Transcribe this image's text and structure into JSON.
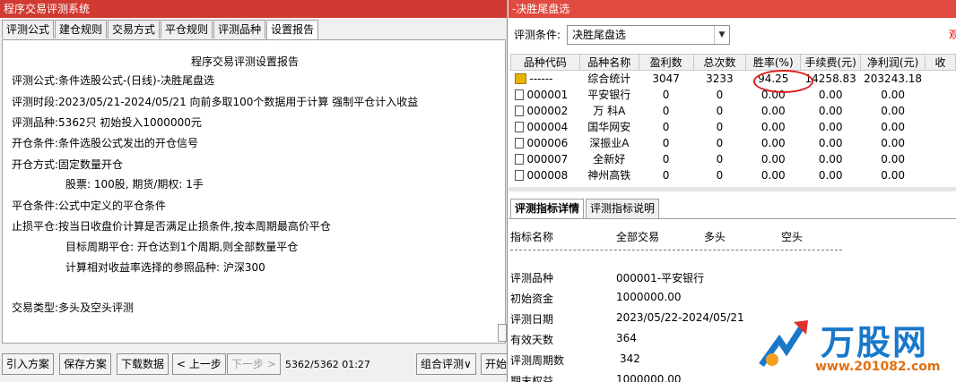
{
  "left": {
    "title": "程序交易评测系统",
    "tabs": [
      "评测公式",
      "建仓规则",
      "交易方式",
      "平仓规则",
      "评测品种",
      "设置报告"
    ],
    "active_tab": 5,
    "report": {
      "title": "程序交易评测设置报告",
      "lines": [
        {
          "k": "评测公式:",
          "v": "条件选股公式-(日线)-决胜尾盘选"
        },
        {
          "k": "评测时段:",
          "v": "2023/05/21-2024/05/21 向前多取100个数据用于计算 强制平仓计入收益"
        },
        {
          "k": "评测品种:",
          "v": "5362只 初始投入1000000元"
        },
        {
          "k": "开仓条件:",
          "v": "条件选股公式发出的开仓信号"
        },
        {
          "k": "开仓方式:",
          "v": "固定数量开仓"
        },
        {
          "k": "",
          "v": "股票: 100股, 期货/期权: 1手"
        },
        {
          "k": "平仓条件:",
          "v": "公式中定义的平仓条件"
        },
        {
          "k": "止损平仓:",
          "v": "按当日收盘价计算是否满足止损条件,按本周期最高价平仓"
        },
        {
          "k": "",
          "v": "目标周期平仓: 开仓达到1个周期,则全部数量平仓"
        },
        {
          "k": "",
          "v": "计算相对收益率选择的参照品种: 沪深300"
        },
        {
          "k": "交易类型:",
          "v": "多头及空头评测"
        }
      ]
    },
    "buttons": {
      "import": "引入方案",
      "save": "保存方案",
      "download": "下载数据",
      "prev": "< 上一步",
      "next": "下一步 >",
      "combo_eval": "组合评测∨",
      "start_clip": "开始"
    },
    "status": "5362/5362  01:27"
  },
  "right": {
    "title": "-决胜尾盘选",
    "condition_label": "评测条件:",
    "condition_value": "决胜尾盘选",
    "red_clip": "观",
    "table": {
      "headers": [
        "品种代码",
        "品种名称",
        "盈利数",
        "总次数",
        "胜率(%)",
        "手续费(元)",
        "净利润(元)",
        "收"
      ],
      "rows": [
        [
          "------",
          "综合统计",
          "3047",
          "3233",
          "94.25",
          "14258.83",
          "203243.18",
          ""
        ],
        [
          "000001",
          "平安银行",
          "0",
          "0",
          "0.00",
          "0.00",
          "0.00",
          ""
        ],
        [
          "000002",
          "万 科A",
          "0",
          "0",
          "0.00",
          "0.00",
          "0.00",
          ""
        ],
        [
          "000004",
          "国华网安",
          "0",
          "0",
          "0.00",
          "0.00",
          "0.00",
          ""
        ],
        [
          "000006",
          "深振业A",
          "0",
          "0",
          "0.00",
          "0.00",
          "0.00",
          ""
        ],
        [
          "000007",
          "全新好",
          "0",
          "0",
          "0.00",
          "0.00",
          "0.00",
          ""
        ],
        [
          "000008",
          "神州高铁",
          "0",
          "0",
          "0.00",
          "0.00",
          "0.00",
          ""
        ]
      ]
    },
    "tabs": [
      "评测指标详情",
      "评测指标说明"
    ],
    "detail": {
      "header": [
        "指标名称",
        "全部交易",
        "多头",
        "空头"
      ],
      "rows": [
        {
          "k": "评测品种",
          "v": "000001-平安银行"
        },
        {
          "k": "初始资金",
          "v": "1000000.00"
        },
        {
          "k": "评测日期",
          "v": "2023/05/22-2024/05/21"
        },
        {
          "k": "有效天数",
          "v": "364"
        },
        {
          "k": "评测周期数",
          "v": "342"
        },
        {
          "k": "期末权益",
          "v": "1000000.00"
        }
      ]
    },
    "watermark": {
      "text": "万股网",
      "url": "www.201082.com"
    }
  },
  "colors": {
    "titlebar_left": "#d03a33",
    "titlebar_right": "#e04a40",
    "highlight_circle": "#e02020"
  }
}
